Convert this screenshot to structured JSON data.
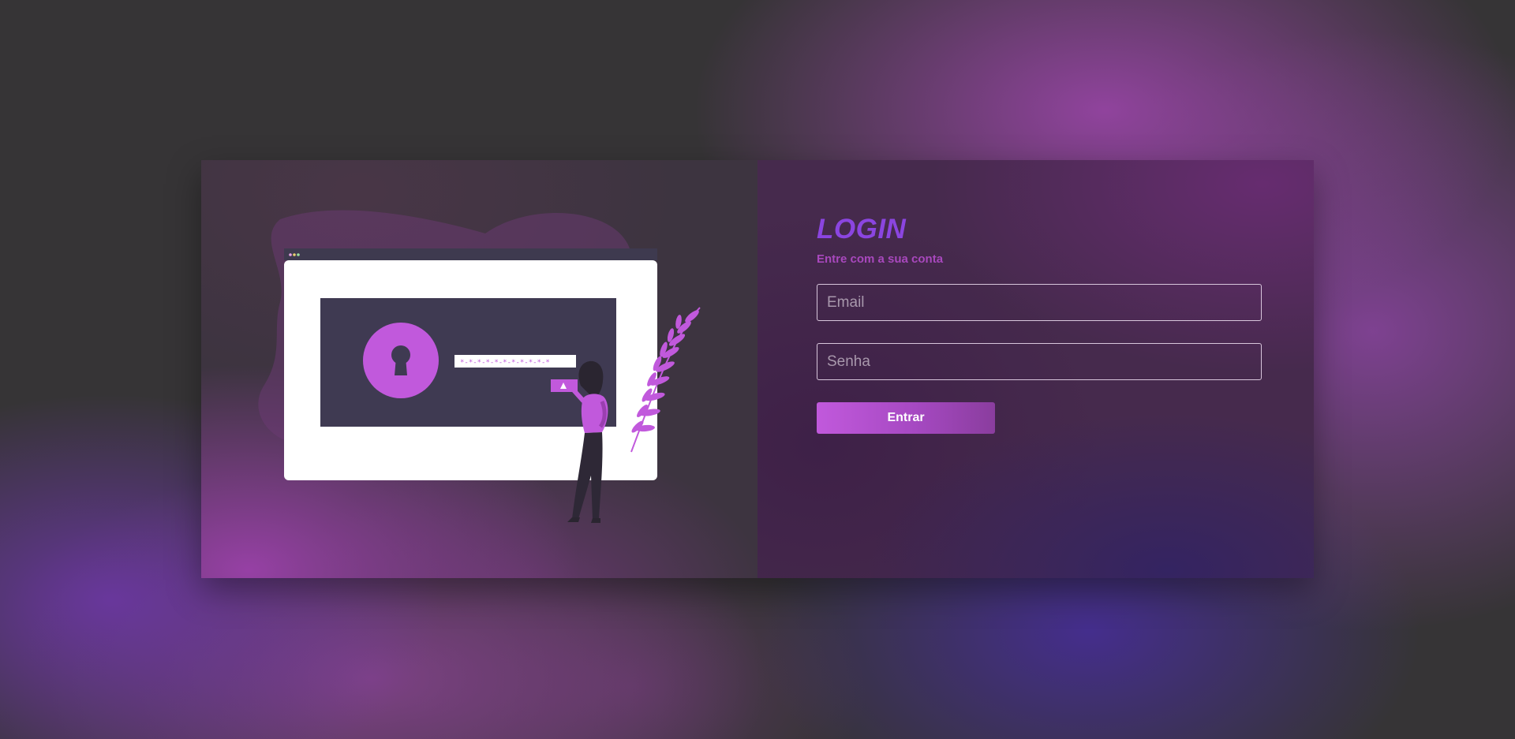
{
  "colors": {
    "accent": "#c159dc",
    "title": "#8b45e0",
    "subtitle": "#a848bd",
    "background": "#363436"
  },
  "illustration": {
    "password_mask": "*-*-*-*-*-*-*-*-*-*-*",
    "icon": "keyhole-icon"
  },
  "login": {
    "title": "LOGIN",
    "subtitle": "Entre com a sua conta",
    "email_placeholder": "Email",
    "password_placeholder": "Senha",
    "submit_label": "Entrar"
  }
}
